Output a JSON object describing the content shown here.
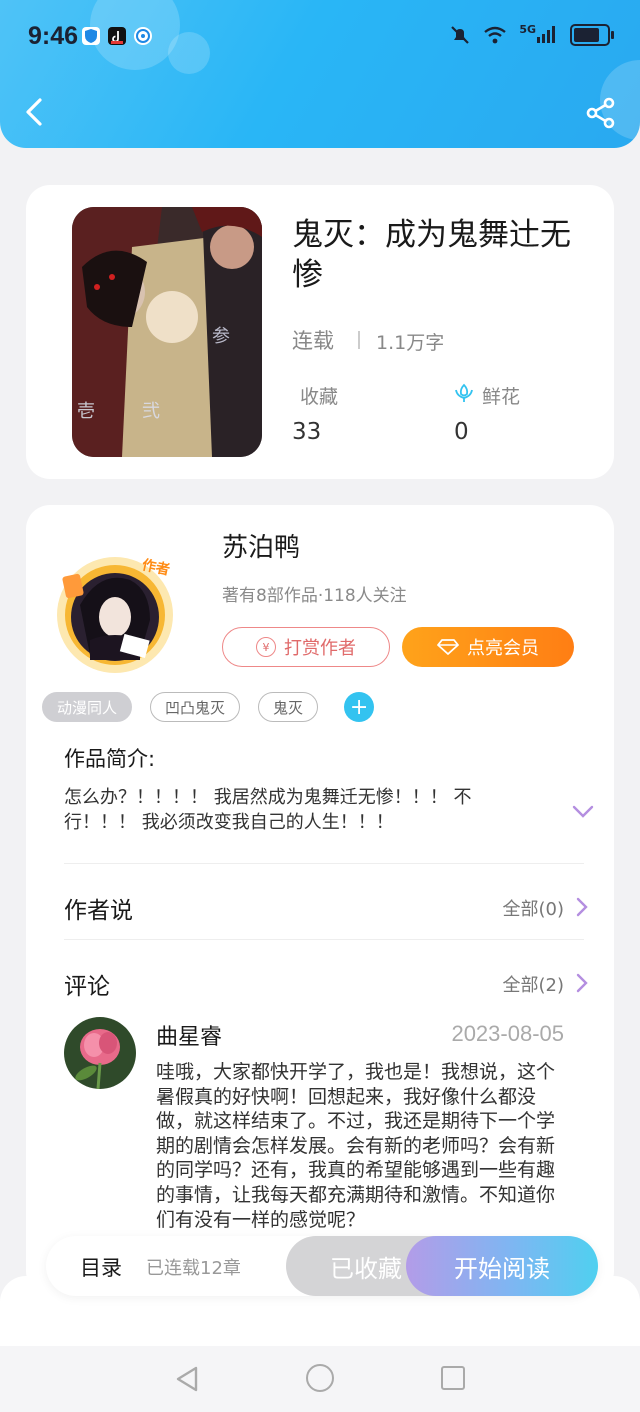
{
  "status_bar": {
    "time": "9:46",
    "network": "5G"
  },
  "header": {
    "back_icon": "chevron-left-icon",
    "share_icon": "share-icon"
  },
  "book": {
    "title": "鬼灭：成为鬼舞辻无惨",
    "status": "连载",
    "word_count": "1.1万字",
    "favorites_label": "收藏",
    "favorites_value": "33",
    "flowers_label": "鲜花",
    "flowers_value": "0"
  },
  "author": {
    "name": "苏泊鸭",
    "meta": "著有8部作品·118人关注",
    "badge": "作者",
    "tip_button": "打赏作者",
    "vip_button": "点亮会员"
  },
  "tags": [
    "动漫同人",
    "凹凸鬼灭",
    "鬼灭"
  ],
  "intro": {
    "title": "作品简介:",
    "text": "怎么办？！！！！ 我居然成为鬼舞迁无惨！！！ 不行！！！ 我必须改变我自己的人生！！！"
  },
  "author_says": {
    "title": "作者说",
    "more": "全部(0)"
  },
  "comments": {
    "title": "评论",
    "more": "全部(2)",
    "items": [
      {
        "name": "曲星睿",
        "date": "2023-08-05",
        "text": "哇哦，大家都快开学了，我也是！我想说，这个暑假真的好快啊！回想起来，我好像什么都没做，就这样结束了。不过，我还是期待下一个学期的剧情会怎样发展。会有新的老师吗？会有新的同学吗？还有，我真的希望能够遇到一些有趣的事情，让我每天都充满期待和激情。不知道你们有没有一样的感觉呢？"
      }
    ]
  },
  "bottom_bar": {
    "toc_label": "目录",
    "toc_count": "已连载12章",
    "favorited_label": "已收藏",
    "read_label": "开始阅读"
  },
  "colors": {
    "header": "#29b6f6",
    "vip": "#ff8c16",
    "tip": "#e06a6a",
    "accent": "#33c3f0",
    "chevron": "#b48ee0"
  }
}
